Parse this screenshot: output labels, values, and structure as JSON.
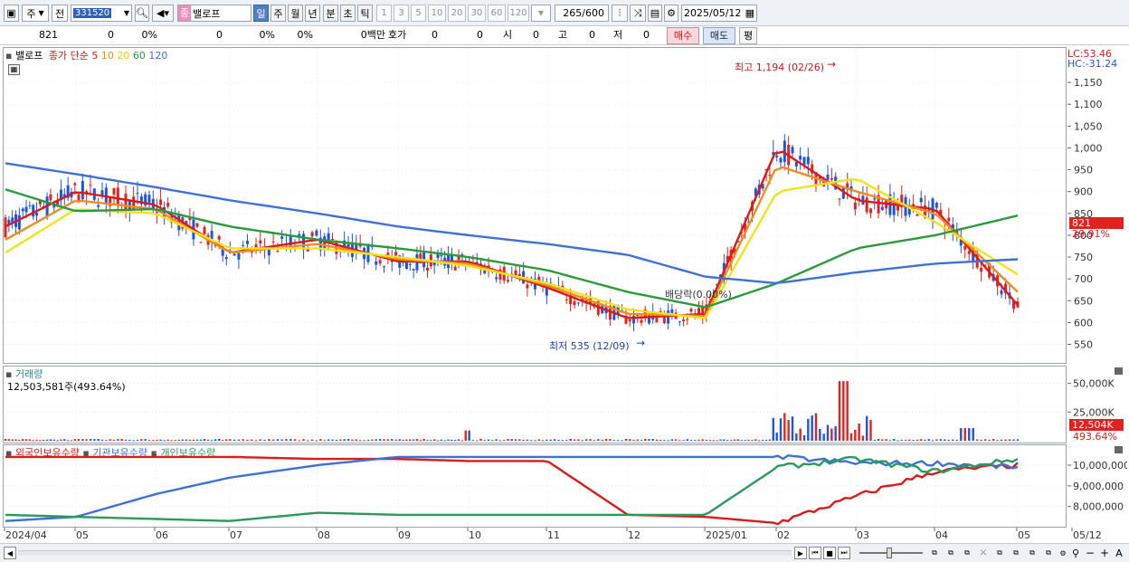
{
  "toolbar": {
    "market_type": "주",
    "prev_label": "전",
    "stock_code": "331520",
    "stock_badge": "종",
    "stock_name": "밸로프",
    "periods": [
      "일",
      "주",
      "월",
      "년",
      "분",
      "초",
      "틱"
    ],
    "selected_period": "일",
    "intervals": [
      "1",
      "3",
      "5",
      "10",
      "20",
      "30",
      "60",
      "120"
    ],
    "count_display": "265",
    "count_max": "/600",
    "date": "2025/05/12"
  },
  "quote": {
    "price": "821",
    "change": "0",
    "change_pct": "0%",
    "v1": "0",
    "v1_pct": "0%",
    "v2_pct": "0%",
    "amount": "0백만",
    "bid_label": "호가",
    "bid1": "0",
    "bid2": "0",
    "open_label": "시",
    "open": "0",
    "high_label": "고",
    "high": "0",
    "low_label": "저",
    "low": "0",
    "buy_label": "매수",
    "sell_label": "매도",
    "avg_label": "평"
  },
  "price_pane": {
    "legend_name": "밸로프",
    "legend_ma_label": "종가 단순",
    "ma_periods": [
      "5",
      "10",
      "20",
      "60",
      "120"
    ],
    "ma_colors": [
      "#d81b1b",
      "#f08c1e",
      "#f2e21a",
      "#2a9a3c",
      "#3f6fd8"
    ],
    "lc": "LC:53.46",
    "hc": "HC:-31.24",
    "current_price_tag": "821",
    "current_pct_tag": "29.91%",
    "high_annotation": "최고 1,194 (02/26)",
    "low_annotation": "최저 535 (12/09)",
    "dividend_annotation": "배당락(0.00%)",
    "y_ticks": [
      "1,150",
      "1,100",
      "1,050",
      "1,000",
      "950",
      "900",
      "850",
      "800",
      "750",
      "700",
      "650",
      "600",
      "550"
    ]
  },
  "volume_pane": {
    "title": "거래량",
    "value_text": "12,503,581주(493.64%)",
    "y_ticks": [
      "50,000K",
      "25,000K"
    ],
    "tag_value": "12,504K",
    "tag_pct": "493.64%"
  },
  "holdings_pane": {
    "series": [
      {
        "name": "외국인보유수량",
        "color": "#d81b1b"
      },
      {
        "name": "기관보유수량",
        "color": "#3f6fd8"
      },
      {
        "name": "개인보유수량",
        "color": "#2a9a5c"
      }
    ],
    "y_ticks": [
      "10,000,000",
      "9,000,000",
      "8,000,000"
    ]
  },
  "x_axis": [
    "2024/04",
    "05",
    "06",
    "07",
    "08",
    "09",
    "10",
    "11",
    "12",
    "2025/01",
    "02",
    "03",
    "04",
    "05",
    "05/12"
  ],
  "chart_data": {
    "type": "line",
    "x": [
      "2024/04",
      "05",
      "06",
      "07",
      "08",
      "09",
      "10",
      "11",
      "12",
      "2025/01",
      "02",
      "03",
      "04",
      "05"
    ],
    "series": [
      {
        "name": "5",
        "values": [
          820,
          900,
          870,
          760,
          790,
          740,
          740,
          680,
          610,
          620,
          1000,
          880,
          860,
          640
        ]
      },
      {
        "name": "10",
        "values": [
          790,
          880,
          860,
          760,
          780,
          745,
          735,
          685,
          620,
          615,
          960,
          900,
          850,
          670
        ]
      },
      {
        "name": "20",
        "values": [
          760,
          860,
          850,
          770,
          770,
          750,
          730,
          690,
          630,
          610,
          900,
          930,
          830,
          710
        ]
      },
      {
        "name": "60",
        "values": [
          905,
          855,
          860,
          820,
          790,
          770,
          750,
          720,
          670,
          635,
          690,
          770,
          800,
          845
        ]
      },
      {
        "name": "120",
        "values": [
          965,
          940,
          910,
          880,
          850,
          820,
          800,
          780,
          755,
          705,
          690,
          715,
          735,
          745
        ]
      }
    ],
    "ylim": [
      520,
      1200
    ],
    "volume_ylim": [
      0,
      60000
    ],
    "volume_unit": "K",
    "holdings": {
      "x": [
        "2024/04",
        "05",
        "06",
        "07",
        "08",
        "09",
        "10",
        "11",
        "12",
        "2025/01",
        "02",
        "03",
        "04",
        "05"
      ],
      "series": [
        {
          "name": "외국인보유수량",
          "values": [
            10400000,
            10400000,
            10400000,
            10400000,
            10300000,
            10300000,
            10200000,
            10200000,
            7600000,
            7500000,
            7200000,
            8500000,
            9700000,
            10000000
          ]
        },
        {
          "name": "기관보유수량",
          "values": [
            7300000,
            7500000,
            8600000,
            9400000,
            10000000,
            10400000,
            10400000,
            10400000,
            10400000,
            10400000,
            10400000,
            10100000,
            10100000,
            9900000
          ]
        },
        {
          "name": "개인보유수량",
          "values": [
            7600000,
            7500000,
            7400000,
            7300000,
            7700000,
            7600000,
            7600000,
            7600000,
            7600000,
            7600000,
            9900000,
            10300000,
            9700000,
            10300000
          ]
        }
      ],
      "ylim": [
        7200000,
        10700000
      ]
    }
  }
}
